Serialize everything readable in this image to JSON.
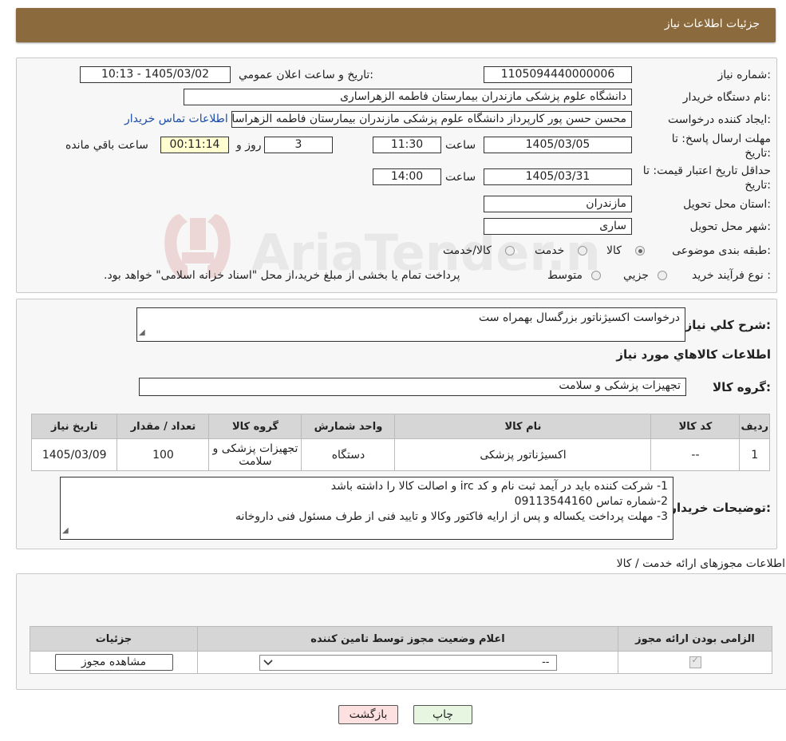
{
  "header": {
    "title": "جزئیات اطلاعات نیاز"
  },
  "form": {
    "need_no_label": "شماره نیاز:",
    "need_no": "1105094440000006",
    "announce_label": "تاريخ و ساعت اعلان عمومي:",
    "announce": "1405/03/02 - 10:13",
    "buyer_label": "نام دستگاه خريدار:",
    "buyer": "دانشگاه علوم پزشکی مازندران بیمارستان فاطمه الزهراساری",
    "creator_label": "ايجاد کننده درخواست:",
    "creator": "محسن حسن پور کارپرداز دانشگاه علوم پزشکی مازندران بیمارستان فاطمه الزهراساری",
    "contact_link": "اطلاعات تماس خریدار",
    "deadline_label_1": "مهلت ارسال پاسخ: تا",
    "deadline_label_2": "تاريخ:",
    "deadline_date": "1405/03/05",
    "hour_label": "ساعت",
    "deadline_time": "11:30",
    "days": "3",
    "days_label": "روز و",
    "remaining": "00:11:14",
    "remaining_label": "ساعت باقي مانده",
    "validity_label_1": "حداقل تاريخ اعتبار قيمت: تا",
    "validity_label_2": "تاريخ:",
    "validity_date": "1405/03/31",
    "validity_time": "14:00",
    "province_label": "استان محل تحويل:",
    "province": "مازندران",
    "city_label": "شهر محل تحويل:",
    "city": "ساری",
    "category_label": "طبقه بندی موضوعی:",
    "category_options": [
      "کالا",
      "خدمت",
      "کالا/خدمت"
    ],
    "process_label": "نوع فرآيند خريد :",
    "process_options": [
      "جزيي",
      "متوسط"
    ],
    "payment_note": "پرداخت تمام یا بخشی از مبلغ خرید،از محل \"اسناد خزانه اسلامی\" خواهد بود."
  },
  "summary": {
    "desc_label": "شرح کلي نياز:",
    "desc": "درخواست اکسیژناتور بزرگسال بهمراه ست",
    "goods_title": "اطلاعات کالاهاي مورد نياز",
    "group_label": "گروه کالا:",
    "group": "تجهیزات پزشکی و سلامت"
  },
  "goods_table": {
    "headers": [
      "رديف",
      "کد کالا",
      "نام کالا",
      "واحد شمارش",
      "گروه کالا",
      "تعداد / مقدار",
      "تاريخ نياز"
    ],
    "rows": [
      [
        "1",
        "--",
        "اکسیژناتور پزشکی",
        "دستگاه",
        "تجهیزات پزشکی و سلامت",
        "100",
        "1405/03/09"
      ]
    ]
  },
  "buyer_notes": {
    "label": "توضيحات خريدار:",
    "lines": [
      "1- شرکت کننده باید در آیمد ثبت نام و کد irc و اصالت کالا را داشته باشد",
      "2-شماره تماس 09113544160",
      "3- مهلت پرداخت یکساله و پس از ارایه فاکتور وکالا و تایید فنی از طرف مسئول فنی داروخانه"
    ]
  },
  "permits": {
    "title": "اطلاعات مجوزهای ارائه خدمت / کالا",
    "headers": [
      "الزامی بودن ارائه مجوز",
      "اعلام وضعیت مجوز توسط تامین کننده",
      "جزئیات"
    ],
    "select_value": "--",
    "view_button": "مشاهده مجوز"
  },
  "buttons": {
    "print": "چاپ",
    "back": "بازگشت"
  },
  "watermark": {
    "text": "AriaTender.neT"
  },
  "colors": {
    "header": "#8b6a3e",
    "back_button": "#fde0e0",
    "print_button": "#e6f6e0",
    "remaining_bg": "#ffffd0",
    "link": "#1a4ca8"
  }
}
